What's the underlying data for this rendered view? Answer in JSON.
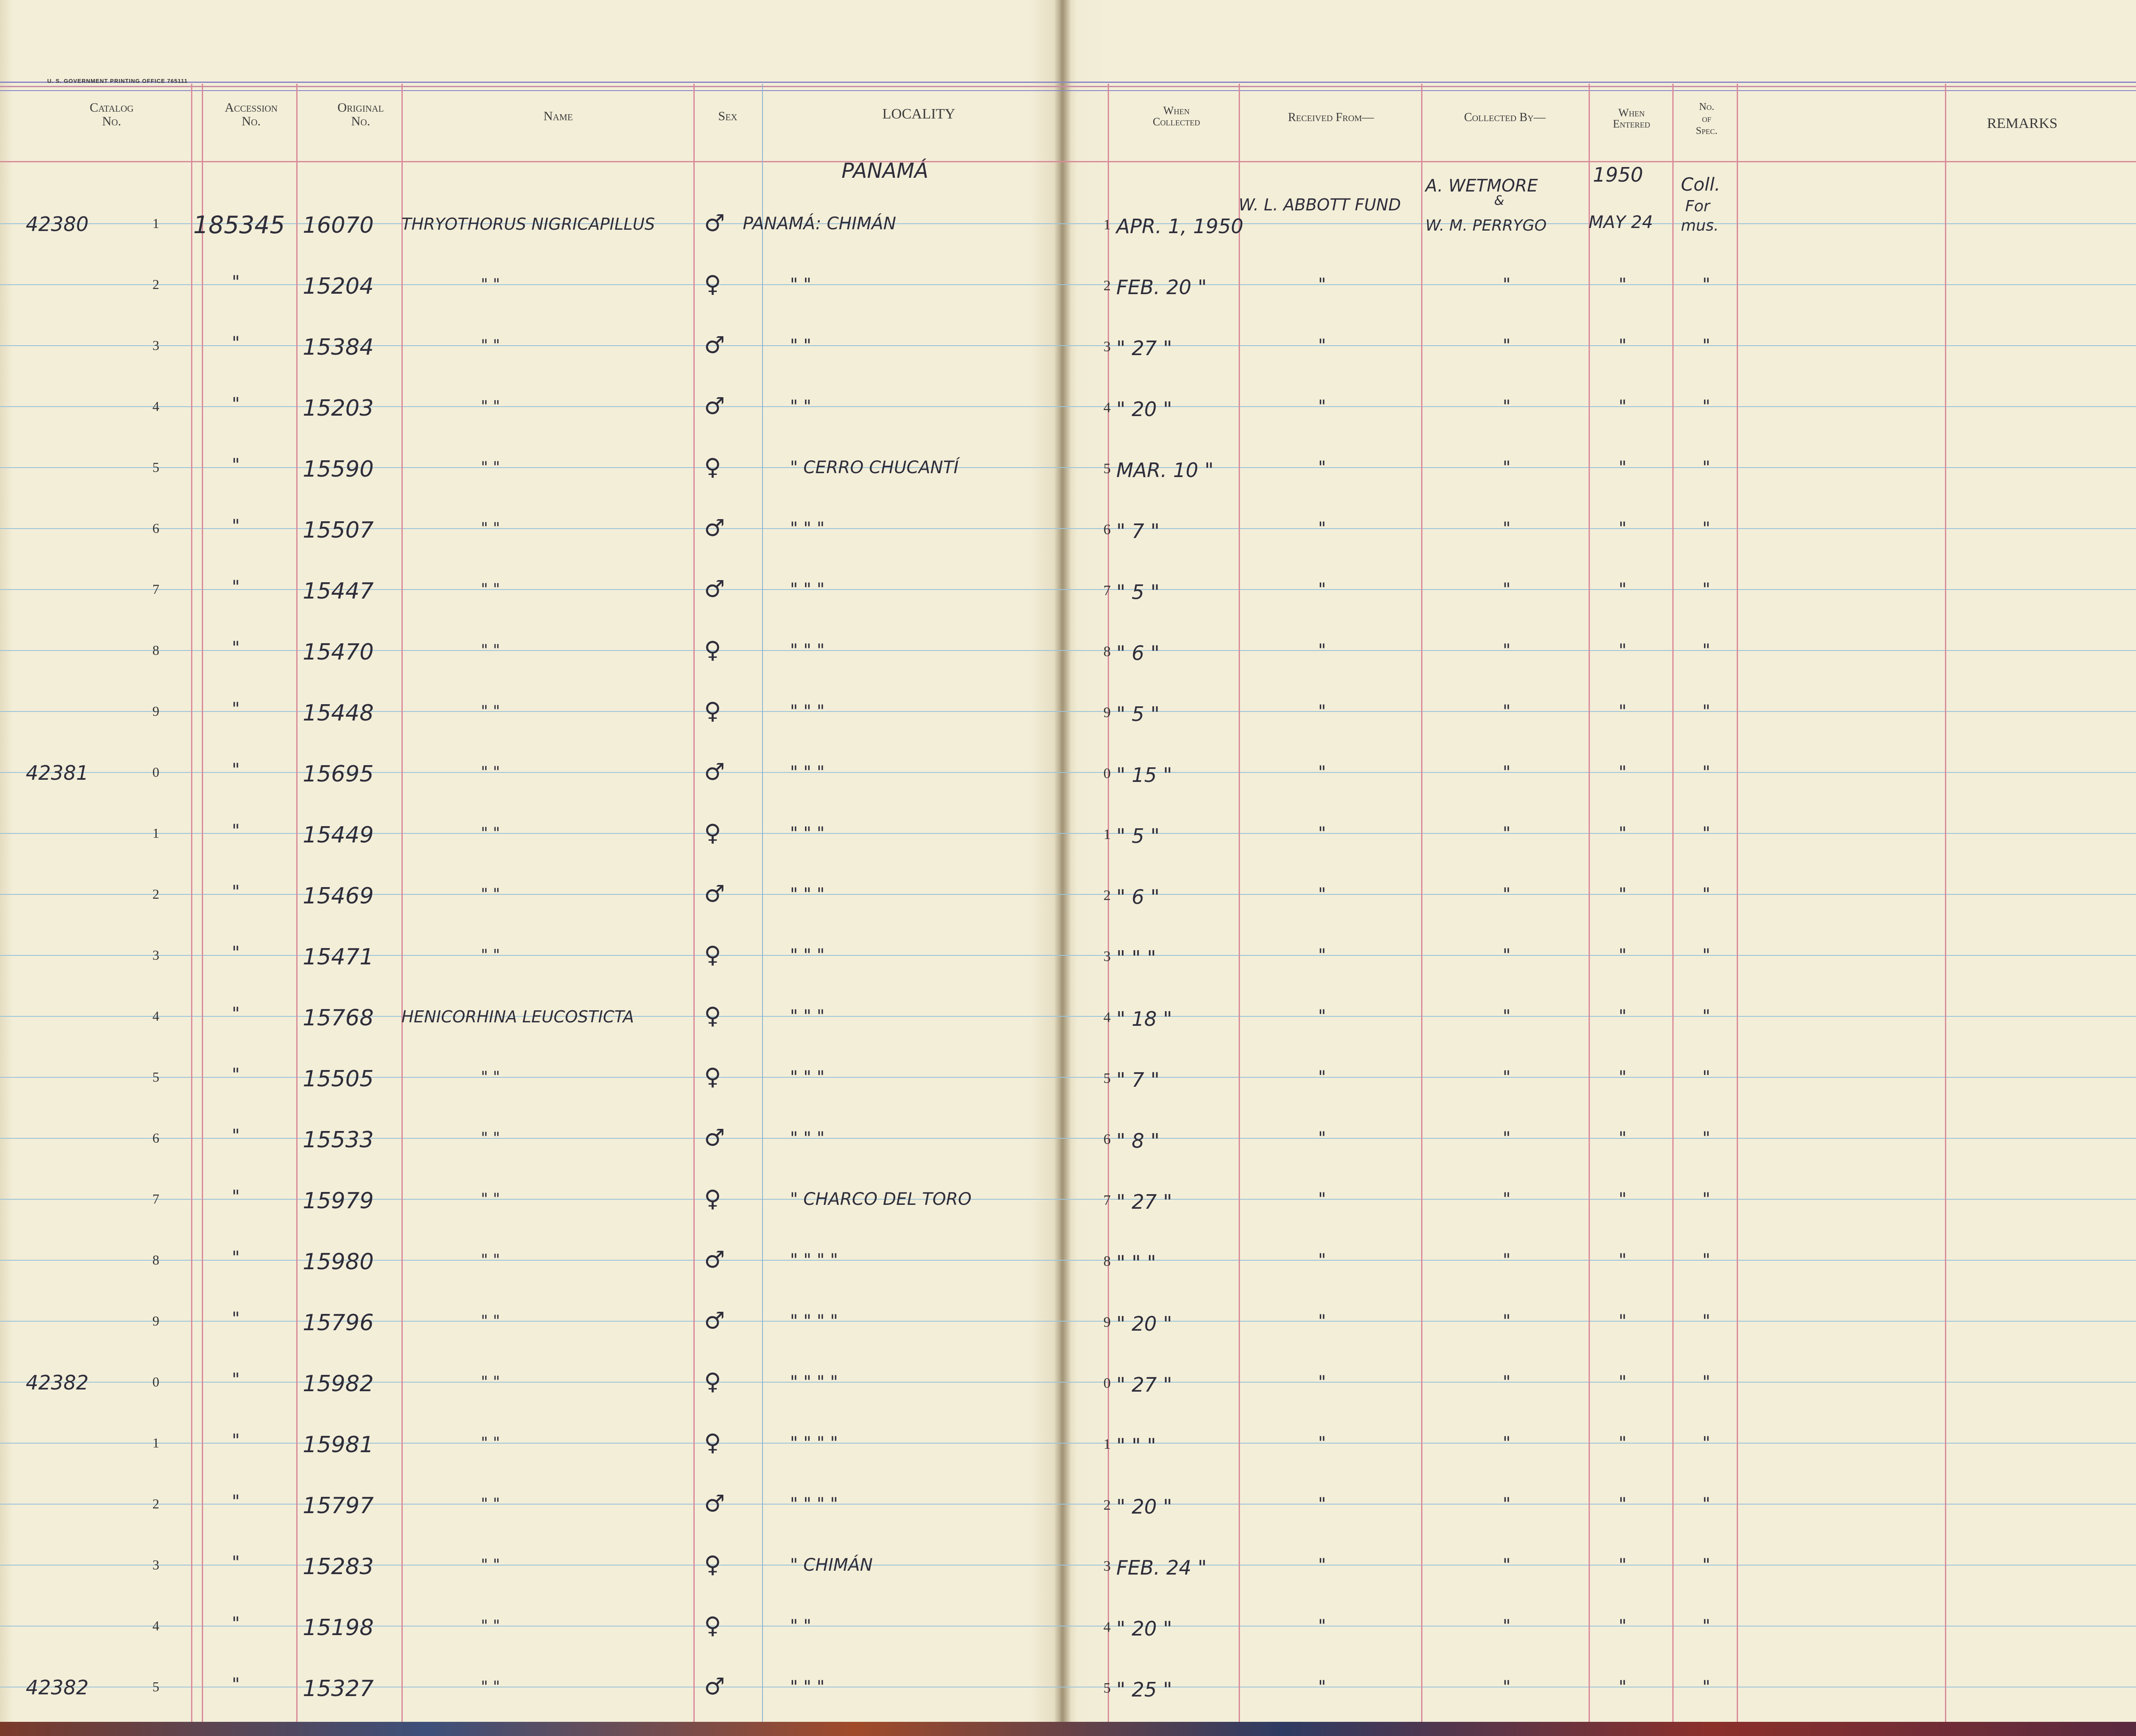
{
  "printer_line": "U. S. GOVERNMENT PRINTING OFFICE   765111",
  "headers": {
    "catalog": [
      "Catalog",
      "No."
    ],
    "accession": [
      "Accession",
      "No."
    ],
    "original": [
      "Original",
      "No."
    ],
    "name": "Name",
    "sex": "Sex",
    "locality": "LOCALITY",
    "when_collected": [
      "When",
      "Collected"
    ],
    "received_from": "Received From—",
    "collected_by": "Collected By—",
    "when_entered": [
      "When",
      "Entered"
    ],
    "no_of_spec": [
      "No.",
      "of",
      "Spec."
    ],
    "remarks": "REMARKS"
  },
  "heading_locality": "PANAMÁ",
  "first_row_extra": {
    "received_from": "W. L. ABBOTT FUND",
    "collected_by_line1": "A. WETMORE",
    "collected_by_amp": "&",
    "collected_by_line2": "W. M. PERRYGO",
    "entered_year": "1950",
    "entered_date": "MAY 24",
    "spec_line1": "Coll.",
    "spec_line2": "For",
    "spec_line3": "mus."
  },
  "rows": [
    {
      "catalog": "42380",
      "digit": "1",
      "accession": "185345",
      "original": "16070",
      "name": "THRYOTHORUS NIGRICAPILLUS",
      "sex": "♂",
      "locality": "PANAMÁ: CHIMÁN",
      "when_digit": "1",
      "when": "APR. 1, 1950",
      "received": "",
      "collected": "",
      "entered": "",
      "spec": ""
    },
    {
      "catalog": "",
      "digit": "2",
      "accession": "\"",
      "original": "15204",
      "name": "\"          \"",
      "sex": "♀",
      "locality": "\"        \"",
      "when_digit": "2",
      "when": "FEB. 20 \"",
      "received": "\"",
      "collected": "\"",
      "entered": "\"",
      "spec": "\""
    },
    {
      "catalog": "",
      "digit": "3",
      "accession": "\"",
      "original": "15384",
      "name": "\"          \"",
      "sex": "♂",
      "locality": "\"        \"",
      "when_digit": "3",
      "when": "\" 27 \"",
      "received": "\"",
      "collected": "\"",
      "entered": "\"",
      "spec": "\""
    },
    {
      "catalog": "",
      "digit": "4",
      "accession": "\"",
      "original": "15203",
      "name": "\"          \"",
      "sex": "♂",
      "locality": "\"        \"",
      "when_digit": "4",
      "when": "\" 20 \"",
      "received": "\"",
      "collected": "\"",
      "entered": "\"",
      "spec": "\""
    },
    {
      "catalog": "",
      "digit": "5",
      "accession": "\"",
      "original": "15590",
      "name": "\"          \"",
      "sex": "♀",
      "locality": "\"   CERRO CHUCANTÍ",
      "when_digit": "5",
      "when": "MAR. 10 \"",
      "received": "\"",
      "collected": "\"",
      "entered": "\"",
      "spec": "\""
    },
    {
      "catalog": "",
      "digit": "6",
      "accession": "\"",
      "original": "15507",
      "name": "\"          \"",
      "sex": "♂",
      "locality": "\"     \"     \"",
      "when_digit": "6",
      "when": "\" 7 \"",
      "received": "\"",
      "collected": "\"",
      "entered": "\"",
      "spec": "\""
    },
    {
      "catalog": "",
      "digit": "7",
      "accession": "\"",
      "original": "15447",
      "name": "\"          \"",
      "sex": "♂",
      "locality": "\"     \"     \"",
      "when_digit": "7",
      "when": "\" 5 \"",
      "received": "\"",
      "collected": "\"",
      "entered": "\"",
      "spec": "\""
    },
    {
      "catalog": "",
      "digit": "8",
      "accession": "\"",
      "original": "15470",
      "name": "\"          \"",
      "sex": "♀",
      "locality": "\"     \"     \"",
      "when_digit": "8",
      "when": "\" 6 \"",
      "received": "\"",
      "collected": "\"",
      "entered": "\"",
      "spec": "\""
    },
    {
      "catalog": "",
      "digit": "9",
      "accession": "\"",
      "original": "15448",
      "name": "\"          \"",
      "sex": "♀",
      "locality": "\"     \"     \"",
      "when_digit": "9",
      "when": "\" 5 \"",
      "received": "\"",
      "collected": "\"",
      "entered": "\"",
      "spec": "\""
    },
    {
      "catalog": "42381",
      "digit": "0",
      "accession": "\"",
      "original": "15695",
      "name": "\"          \"",
      "sex": "♂",
      "locality": "\"     \"     \"",
      "when_digit": "0",
      "when": "\" 15 \"",
      "received": "\"",
      "collected": "\"",
      "entered": "\"",
      "spec": "\""
    },
    {
      "catalog": "",
      "digit": "1",
      "accession": "\"",
      "original": "15449",
      "name": "\"          \"",
      "sex": "♀",
      "locality": "\"     \"     \"",
      "when_digit": "1",
      "when": "\" 5 \"",
      "received": "\"",
      "collected": "\"",
      "entered": "\"",
      "spec": "\""
    },
    {
      "catalog": "",
      "digit": "2",
      "accession": "\"",
      "original": "15469",
      "name": "\"          \"",
      "sex": "♂",
      "locality": "\"     \"     \"",
      "when_digit": "2",
      "when": "\" 6 \"",
      "received": "\"",
      "collected": "\"",
      "entered": "\"",
      "spec": "\""
    },
    {
      "catalog": "",
      "digit": "3",
      "accession": "\"",
      "original": "15471",
      "name": "\"          \"",
      "sex": "♀",
      "locality": "\"     \"     \"",
      "when_digit": "3",
      "when": "\" \" \"",
      "received": "\"",
      "collected": "\"",
      "entered": "\"",
      "spec": "\""
    },
    {
      "catalog": "",
      "digit": "4",
      "accession": "\"",
      "original": "15768",
      "name": "HENICORHINA LEUCOSTICTA",
      "sex": "♀",
      "locality": "\"     \"     \"",
      "when_digit": "4",
      "when": "\" 18 \"",
      "received": "\"",
      "collected": "\"",
      "entered": "\"",
      "spec": "\""
    },
    {
      "catalog": "",
      "digit": "5",
      "accession": "\"",
      "original": "15505",
      "name": "\"          \"",
      "sex": "♀",
      "locality": "\"     \"     \"",
      "when_digit": "5",
      "when": "\" 7 \"",
      "received": "\"",
      "collected": "\"",
      "entered": "\"",
      "spec": "\""
    },
    {
      "catalog": "",
      "digit": "6",
      "accession": "\"",
      "original": "15533",
      "name": "\"          \"",
      "sex": "♂",
      "locality": "\"     \"     \"",
      "when_digit": "6",
      "when": "\" 8 \"",
      "received": "\"",
      "collected": "\"",
      "entered": "\"",
      "spec": "\""
    },
    {
      "catalog": "",
      "digit": "7",
      "accession": "\"",
      "original": "15979",
      "name": "\"          \"",
      "sex": "♀",
      "locality": "\"  CHARCO DEL TORO",
      "when_digit": "7",
      "when": "\" 27 \"",
      "received": "\"",
      "collected": "\"",
      "entered": "\"",
      "spec": "\""
    },
    {
      "catalog": "",
      "digit": "8",
      "accession": "\"",
      "original": "15980",
      "name": "\"          \"",
      "sex": "♂",
      "locality": "\"    \"    \"    \"",
      "when_digit": "8",
      "when": "\" \" \"",
      "received": "\"",
      "collected": "\"",
      "entered": "\"",
      "spec": "\""
    },
    {
      "catalog": "",
      "digit": "9",
      "accession": "\"",
      "original": "15796",
      "name": "\"          \"",
      "sex": "♂",
      "locality": "\"    \"    \"    \"",
      "when_digit": "9",
      "when": "\" 20 \"",
      "received": "\"",
      "collected": "\"",
      "entered": "\"",
      "spec": "\""
    },
    {
      "catalog": "42382",
      "digit": "0",
      "accession": "\"",
      "original": "15982",
      "name": "\"          \"",
      "sex": "♀",
      "locality": "\"    \"    \"    \"",
      "when_digit": "0",
      "when": "\" 27 \"",
      "received": "\"",
      "collected": "\"",
      "entered": "\"",
      "spec": "\""
    },
    {
      "catalog": "",
      "digit": "1",
      "accession": "\"",
      "original": "15981",
      "name": "\"          \"",
      "sex": "♀",
      "locality": "\"    \"    \"    \"",
      "when_digit": "1",
      "when": "\" \" \"",
      "received": "\"",
      "collected": "\"",
      "entered": "\"",
      "spec": "\""
    },
    {
      "catalog": "",
      "digit": "2",
      "accession": "\"",
      "original": "15797",
      "name": "\"          \"",
      "sex": "♂",
      "locality": "\"    \"    \"    \"",
      "when_digit": "2",
      "when": "\" 20 \"",
      "received": "\"",
      "collected": "\"",
      "entered": "\"",
      "spec": "\""
    },
    {
      "catalog": "",
      "digit": "3",
      "accession": "\"",
      "original": "15283",
      "name": "\"          \"",
      "sex": "♀",
      "locality": "\"   CHIMÁN",
      "when_digit": "3",
      "when": "FEB. 24 \"",
      "received": "\"",
      "collected": "\"",
      "entered": "\"",
      "spec": "\""
    },
    {
      "catalog": "",
      "digit": "4",
      "accession": "\"",
      "original": "15198",
      "name": "\"          \"",
      "sex": "♀",
      "locality": "\"     \"",
      "when_digit": "4",
      "when": "\" 20 \"",
      "received": "\"",
      "collected": "\"",
      "entered": "\"",
      "spec": "\""
    },
    {
      "catalog": "42382",
      "digit": "5",
      "accession": "\"",
      "original": "15327",
      "name": "\"          \"",
      "sex": "♂",
      "locality": "\"     \"     \"",
      "when_digit": "5",
      "when": "\" 25 \"",
      "received": "\"",
      "collected": "\"",
      "entered": "\"",
      "spec": "\""
    }
  ]
}
